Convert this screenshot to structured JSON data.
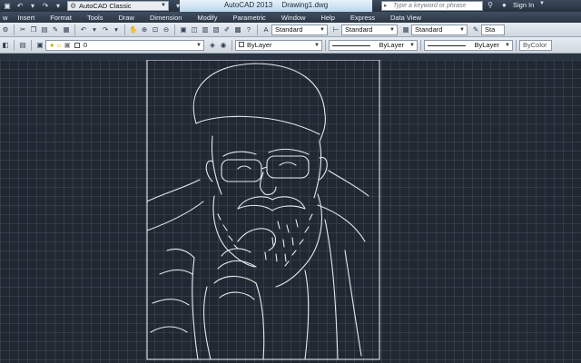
{
  "titlebar": {
    "workspace": "AutoCAD Classic",
    "app_title": "AutoCAD 2013",
    "document": "Drawing1.dwg",
    "search_placeholder": "Type a keyword or phrase",
    "signin": "Sign In"
  },
  "menu": [
    "w",
    "Insert",
    "Format",
    "Tools",
    "Draw",
    "Dimension",
    "Modify",
    "Parametric",
    "Window",
    "Help",
    "Express",
    "Data View"
  ],
  "toolbar2": {
    "layer": "0",
    "text_style_1": "Standard",
    "text_style_2": "Standard",
    "text_style_3": "Standard",
    "text_style_4": "Sta",
    "color": "ByLayer",
    "linetype": "ByLayer",
    "lineweight": "ByLayer",
    "plotstyle": "ByColor"
  },
  "colors": {
    "canvas": "#212832",
    "grid": "#4f5f73",
    "drawing": "#e6e9ee"
  }
}
